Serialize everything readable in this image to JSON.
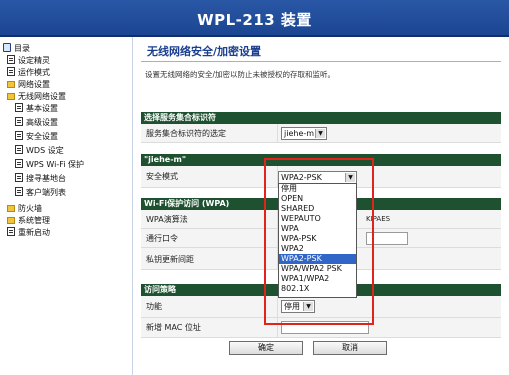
{
  "header": {
    "title": "WPL-213 装置"
  },
  "sidebar": {
    "items": [
      {
        "label": "目录"
      },
      {
        "label": "设定精灵"
      },
      {
        "label": "运作模式"
      },
      {
        "label": "网络设置"
      },
      {
        "label": "无线网络设置"
      },
      {
        "label": "基本设置"
      },
      {
        "label": "高级设置"
      },
      {
        "label": "安全设置"
      },
      {
        "label": "WDS 设定"
      },
      {
        "label": "WPS Wi-Fi 保护"
      },
      {
        "label": "搜寻基地台"
      },
      {
        "label": "客户端列表"
      },
      {
        "label": "防火墙"
      },
      {
        "label": "系统管理"
      },
      {
        "label": "重新启动"
      }
    ]
  },
  "main": {
    "title": "无线网络安全/加密设置",
    "description": "设置无线网络的安全/加密以防止未被授权的存取和监听。",
    "ssid_section": {
      "header": "选择服务集合标识符",
      "label": "服务集合标识符的选定",
      "value": "jiehe-m"
    },
    "ssid_name_bar": "\"jiehe-m\"",
    "security": {
      "label": "安全模式",
      "value": "WPA2-PSK",
      "options": [
        "停用",
        "OPEN",
        "SHARED",
        "WEPAUTO",
        "WPA",
        "WPA-PSK",
        "WPA2",
        "WPA2-PSK",
        "WPA/WPA2 PSK",
        "WPA1/WPA2",
        "802.1X"
      ]
    },
    "wpa_section": {
      "header": "Wi-Fi保护访问 (WPA)",
      "algorithm_label": "WPA演算法",
      "algorithm_partial": "KIPAES",
      "passphrase_label": "通行口令",
      "rekey_label": "私钥更新间距"
    },
    "access_section": {
      "header": "访问策略",
      "function_label": "功能",
      "function_value": "停用",
      "add_mac_label": "新增 MAC 位址"
    },
    "buttons": {
      "ok": "确定",
      "cancel": "取消"
    }
  }
}
